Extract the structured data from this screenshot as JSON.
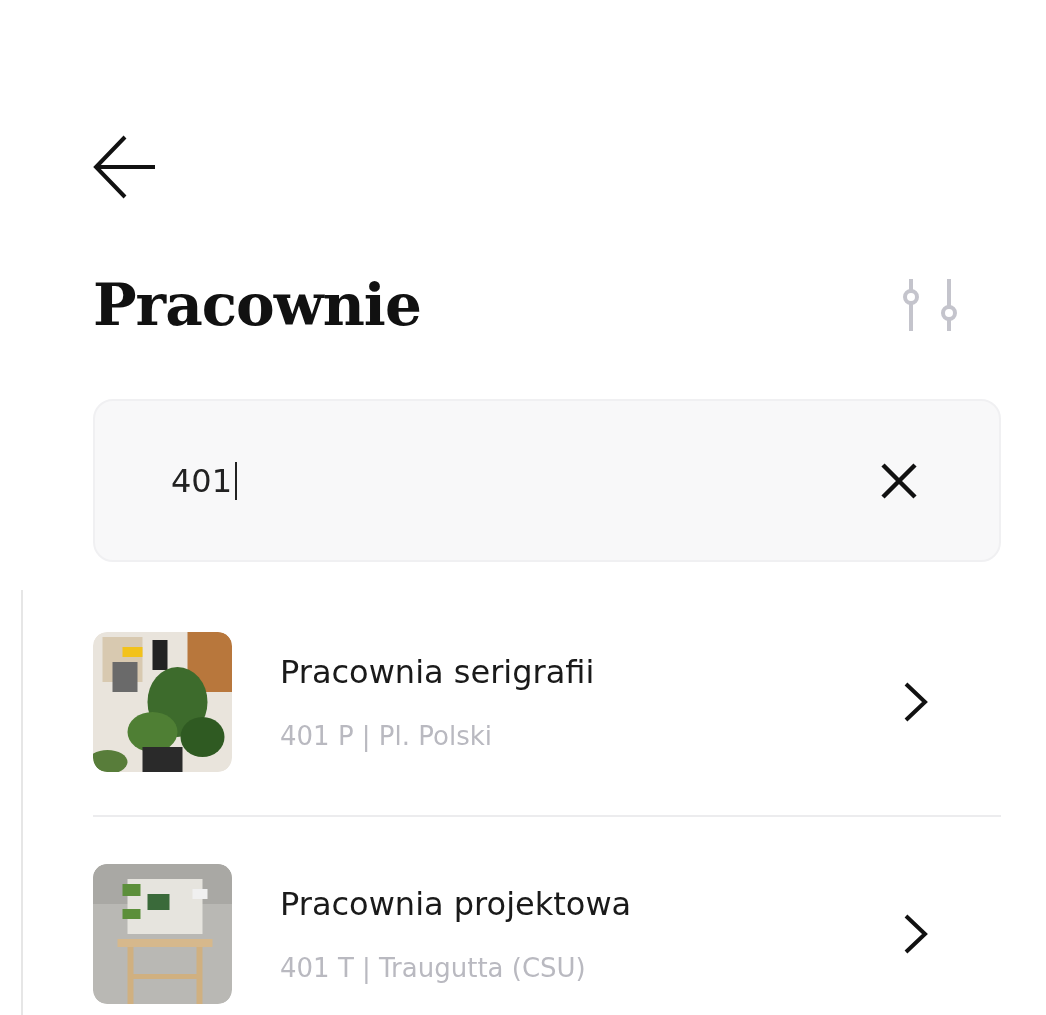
{
  "header": {
    "title": "Pracownie"
  },
  "search": {
    "value": "401",
    "focused": true
  },
  "results": [
    {
      "title": "Pracownia serigrafii",
      "subtitle": "401 P | Pl. Polski"
    },
    {
      "title": "Pracownia projektowa",
      "subtitle": "401 T | Traugutta (CSU)"
    }
  ]
}
